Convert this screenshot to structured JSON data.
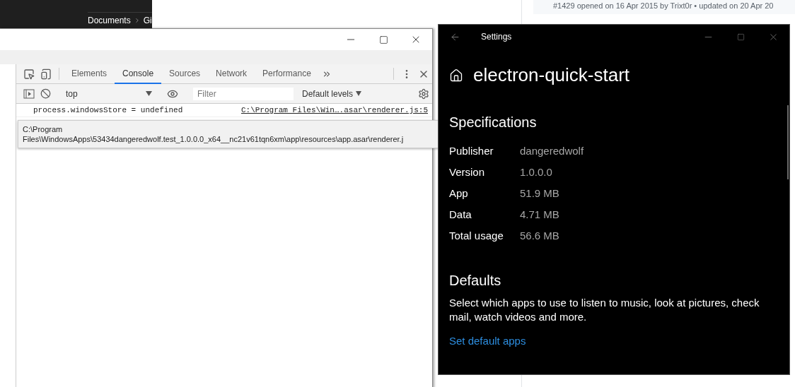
{
  "background_explorer": {
    "breadcrumb": [
      {
        "label": "Documents"
      },
      {
        "label": "Gi"
      }
    ]
  },
  "background_page": {
    "issue_meta": "#1429 opened on 16 Apr 2015 by Trixt0r • updated on 20 Apr 20"
  },
  "devtools": {
    "tabs": [
      {
        "label": "Elements",
        "selected": false
      },
      {
        "label": "Console",
        "selected": true
      },
      {
        "label": "Sources",
        "selected": false
      },
      {
        "label": "Network",
        "selected": false
      },
      {
        "label": "Performance",
        "selected": false
      }
    ],
    "context": "top",
    "filter_placeholder": "Filter",
    "levels": "Default levels",
    "console": [
      {
        "message": "process.windowsStore = undefined",
        "source": "C:\\Program Files\\Win….asar\\renderer.js:5"
      }
    ],
    "tooltip": "C:\\Program Files\\WindowsApps\\53434dangeredwolf.test_1.0.0.0_x64__nc21v61tqn6xm\\app\\resources\\app.asar\\renderer.j"
  },
  "settings": {
    "title": "Settings",
    "app_name": "electron-quick-start",
    "specs_heading": "Specifications",
    "specs": [
      {
        "label": "Publisher",
        "value": "dangeredwolf"
      },
      {
        "label": "Version",
        "value": "1.0.0.0"
      },
      {
        "label": "App",
        "value": "51.9 MB"
      },
      {
        "label": "Data",
        "value": "4.71 MB"
      },
      {
        "label": "Total usage",
        "value": "56.6 MB"
      }
    ],
    "defaults_heading": "Defaults",
    "defaults_text": "Select which apps to use to listen to music, look at pictures, check mail, watch videos and more.",
    "link": "Set default apps"
  }
}
